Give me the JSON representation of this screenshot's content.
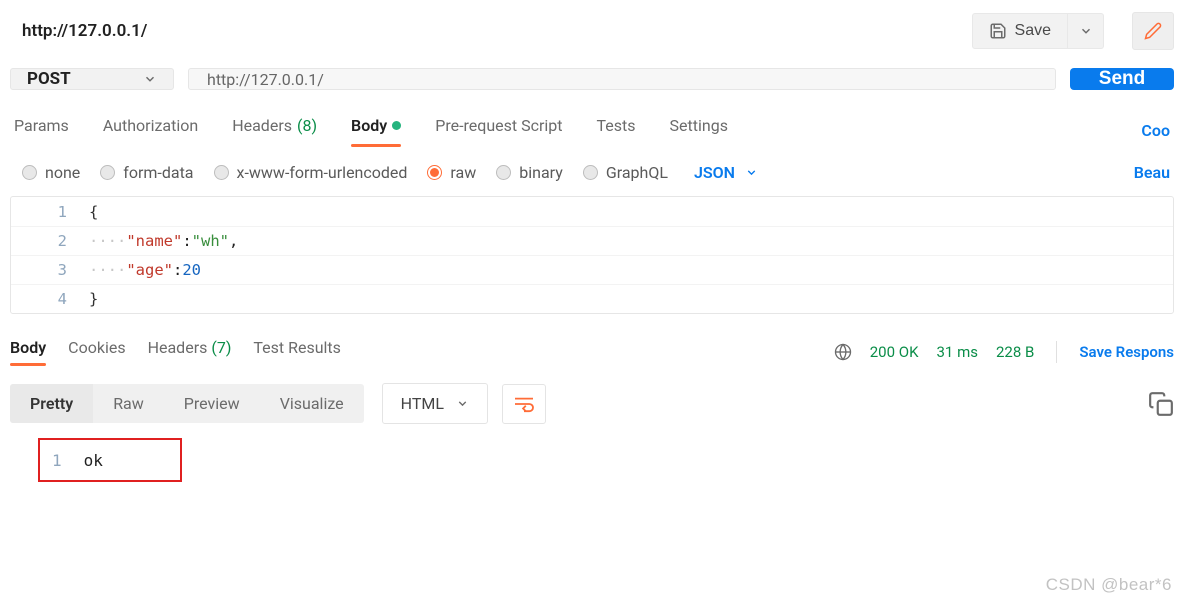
{
  "title": "http://127.0.0.1/",
  "top": {
    "save_label": "Save",
    "edit_title": "Edit"
  },
  "request": {
    "method": "POST",
    "url": "http://127.0.0.1/",
    "send_label": "Send",
    "tabs": {
      "params": "Params",
      "auth": "Authorization",
      "headers": "Headers",
      "headers_count": "(8)",
      "body": "Body",
      "prerequest": "Pre-request Script",
      "tests": "Tests",
      "settings": "Settings"
    },
    "cookies_link": "Coo",
    "body_types": {
      "none": "none",
      "formdata": "form-data",
      "urlencoded": "x-www-form-urlencoded",
      "raw": "raw",
      "binary": "binary",
      "graphql": "GraphQL"
    },
    "raw_format": "JSON",
    "beautify_link": "Beau",
    "code_lines": [
      {
        "n": "1",
        "raw": "{"
      },
      {
        "n": "2",
        "key": "\"name\"",
        "sep": ":",
        "val": "\"wh\"",
        "tail": ","
      },
      {
        "n": "3",
        "key": "\"age\"",
        "sep": ":",
        "num": "20"
      },
      {
        "n": "4",
        "raw": "}"
      }
    ]
  },
  "response": {
    "tabs": {
      "body": "Body",
      "cookies": "Cookies",
      "headers": "Headers",
      "headers_count": "(7)",
      "tests": "Test Results"
    },
    "status_code": "200 OK",
    "time": "31 ms",
    "size": "228 B",
    "save_label": "Save Respons",
    "view_tabs": {
      "pretty": "Pretty",
      "raw": "Raw",
      "preview": "Preview",
      "visualize": "Visualize"
    },
    "format": "HTML",
    "body_lines": [
      {
        "n": "1",
        "text": "ok"
      }
    ]
  },
  "watermark": "CSDN @bear*6"
}
